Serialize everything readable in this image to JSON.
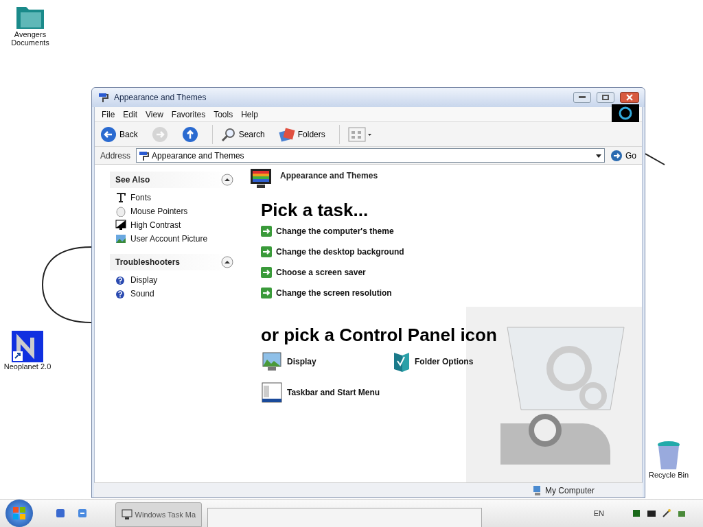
{
  "desktop_icons": [
    {
      "kind": "folder",
      "label": "Avengers Documents"
    },
    {
      "kind": "app",
      "label": "Neoplanet 2.0"
    },
    {
      "kind": "bin",
      "label": "Recycle Bin"
    }
  ],
  "window": {
    "title": "Appearance and Themes",
    "menu": [
      "File",
      "Edit",
      "View",
      "Favorites",
      "Tools",
      "Help"
    ],
    "toolbar": [
      {
        "kind": "back",
        "label": "Back",
        "disabled": false
      },
      {
        "kind": "forward",
        "disabled": true
      },
      {
        "kind": "up",
        "disabled": false
      },
      {
        "kind": "search",
        "label": "Search",
        "disabled": false
      },
      {
        "kind": "folders",
        "label": "Folders",
        "disabled": false
      },
      {
        "kind": "views",
        "disabled": false
      }
    ],
    "address": {
      "label": "Address",
      "value": "Appearance and Themes",
      "go": "Go"
    },
    "sidebar": [
      {
        "title": "See Also",
        "expanded": true,
        "items": [
          {
            "kind": "font",
            "label": "Fonts"
          },
          {
            "kind": "mouse",
            "label": "Mouse Pointers"
          },
          {
            "kind": "contrast",
            "label": "High Contrast"
          },
          {
            "kind": "picture",
            "label": "User Account Picture"
          }
        ]
      },
      {
        "title": "Troubleshooters",
        "expanded": true,
        "items": [
          {
            "kind": "help",
            "label": "Display"
          },
          {
            "kind": "help",
            "label": "Sound"
          }
        ]
      }
    ],
    "category": "Appearance and Themes",
    "task_heading": "Pick a task...",
    "tasks": [
      "Change the computer's theme",
      "Change the desktop background",
      "Choose a screen saver",
      "Change the screen resolution"
    ],
    "icon_heading": "or pick a Control Panel icon",
    "icons": [
      {
        "kind": "display",
        "label": "Display"
      },
      {
        "kind": "folder",
        "label": "Folder Options"
      },
      {
        "kind": "taskbar",
        "label": "Taskbar and Start Menu"
      }
    ],
    "status": "My Computer"
  },
  "taskbar": {
    "buttons": [
      {
        "label": "Windows Task Ma",
        "selected": false
      }
    ],
    "language": "EN"
  }
}
